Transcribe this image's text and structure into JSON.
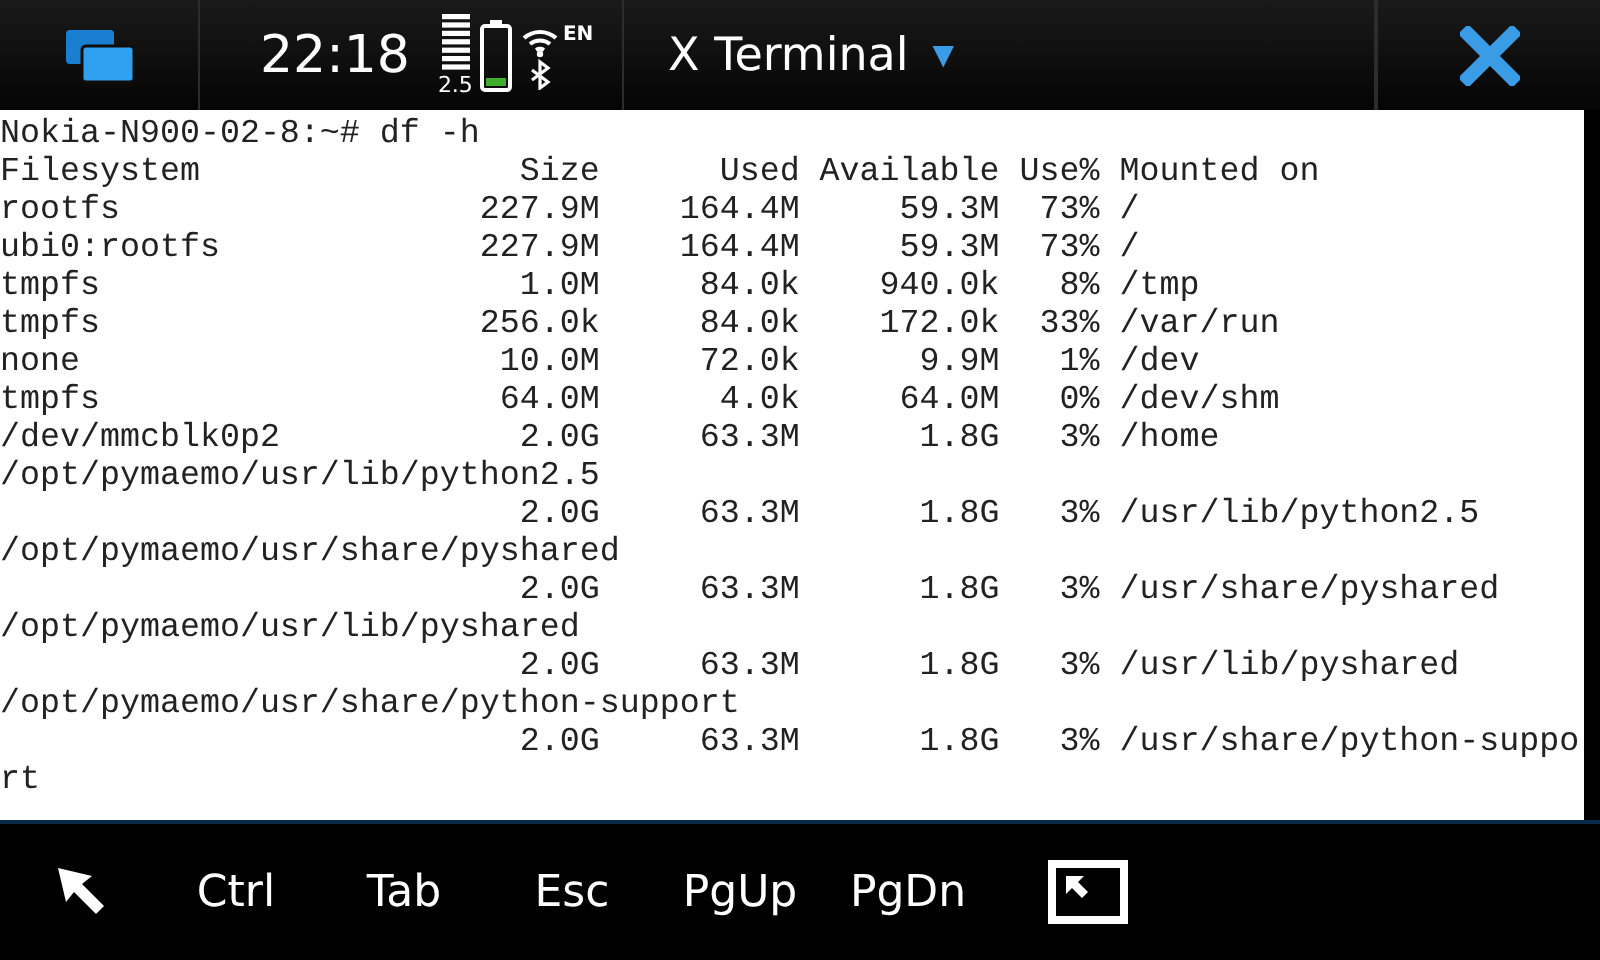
{
  "status_bar": {
    "clock": "22:18",
    "network_type": "2.5",
    "language": "EN"
  },
  "title": {
    "text": "X Terminal",
    "menu_indicator": "▼"
  },
  "terminal": {
    "prompt": "Nokia-N900-02-8:~# df -h",
    "header": {
      "filesystem": "Filesystem",
      "size": "Size",
      "used": "Used",
      "available": "Available",
      "use": "Use%",
      "mounted": "Mounted on"
    },
    "rows": [
      {
        "filesystem": "rootfs",
        "size": "227.9M",
        "used": "164.4M",
        "available": "59.3M",
        "use": "73%",
        "mounted": "/"
      },
      {
        "filesystem": "ubi0:rootfs",
        "size": "227.9M",
        "used": "164.4M",
        "available": "59.3M",
        "use": "73%",
        "mounted": "/"
      },
      {
        "filesystem": "tmpfs",
        "size": "1.0M",
        "used": "84.0k",
        "available": "940.0k",
        "use": "8%",
        "mounted": "/tmp"
      },
      {
        "filesystem": "tmpfs",
        "size": "256.0k",
        "used": "84.0k",
        "available": "172.0k",
        "use": "33%",
        "mounted": "/var/run"
      },
      {
        "filesystem": "none",
        "size": "10.0M",
        "used": "72.0k",
        "available": "9.9M",
        "use": "1%",
        "mounted": "/dev"
      },
      {
        "filesystem": "tmpfs",
        "size": "64.0M",
        "used": "4.0k",
        "available": "64.0M",
        "use": "0%",
        "mounted": "/dev/shm"
      },
      {
        "filesystem": "/dev/mmcblk0p2",
        "size": "2.0G",
        "used": "63.3M",
        "available": "1.8G",
        "use": "3%",
        "mounted": "/home"
      },
      {
        "filesystem": "/opt/pymaemo/usr/lib/python2.5",
        "size": "2.0G",
        "used": "63.3M",
        "available": "1.8G",
        "use": "3%",
        "mounted": "/usr/lib/python2.5"
      },
      {
        "filesystem": "/opt/pymaemo/usr/share/pyshared",
        "size": "2.0G",
        "used": "63.3M",
        "available": "1.8G",
        "use": "3%",
        "mounted": "/usr/share/pyshared"
      },
      {
        "filesystem": "/opt/pymaemo/usr/lib/pyshared",
        "size": "2.0G",
        "used": "63.3M",
        "available": "1.8G",
        "use": "3%",
        "mounted": "/usr/lib/pyshared"
      },
      {
        "filesystem": "/opt/pymaemo/usr/share/python-support",
        "size": "2.0G",
        "used": "63.3M",
        "available": "1.8G",
        "use": "3%",
        "mounted": "/usr/share/python-support"
      }
    ]
  },
  "toolbar": {
    "keys": [
      "Ctrl",
      "Tab",
      "Esc",
      "PgUp",
      "PgDn"
    ]
  }
}
